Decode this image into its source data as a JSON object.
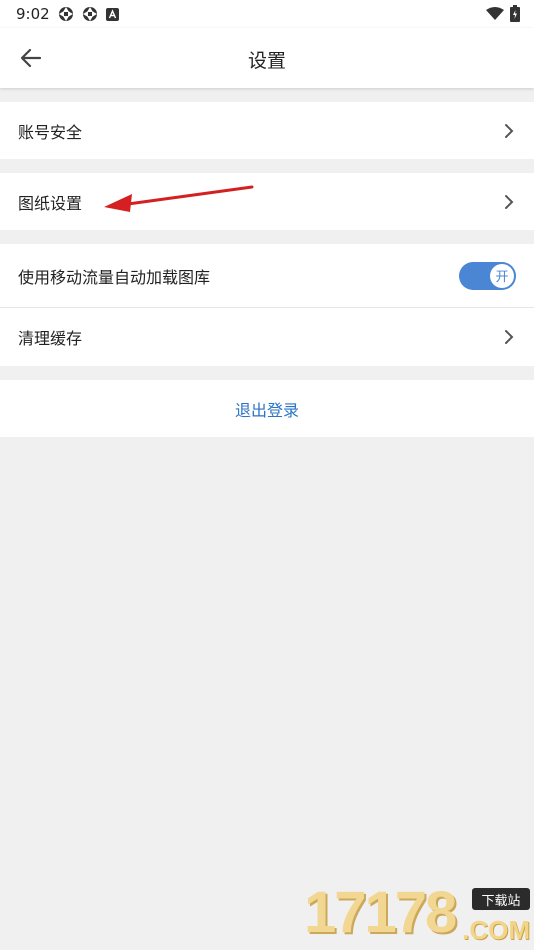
{
  "status_bar": {
    "time": "9:02",
    "left_icons": [
      "aperture-icon",
      "aperture-icon",
      "a-notification-icon"
    ],
    "right_icons": [
      "wifi-icon",
      "battery-icon"
    ]
  },
  "app_bar": {
    "title": "设置",
    "back_icon": "arrow-left-icon"
  },
  "settings": {
    "account_security": "账号安全",
    "drawing_settings": "图纸设置",
    "mobile_data_autoload": "使用移动流量自动加载图库",
    "mobile_data_toggle_label": "开",
    "mobile_data_toggle_on": true,
    "clear_cache": "清理缓存"
  },
  "logout": {
    "label": "退出登录"
  },
  "colors": {
    "accent": "#4a86d4",
    "link": "#2a74c6",
    "annotation_arrow": "#d42020",
    "background": "#f0f0f0"
  },
  "watermark": {
    "number": "17178",
    "badge": "下载站",
    "suffix": ".COM"
  }
}
